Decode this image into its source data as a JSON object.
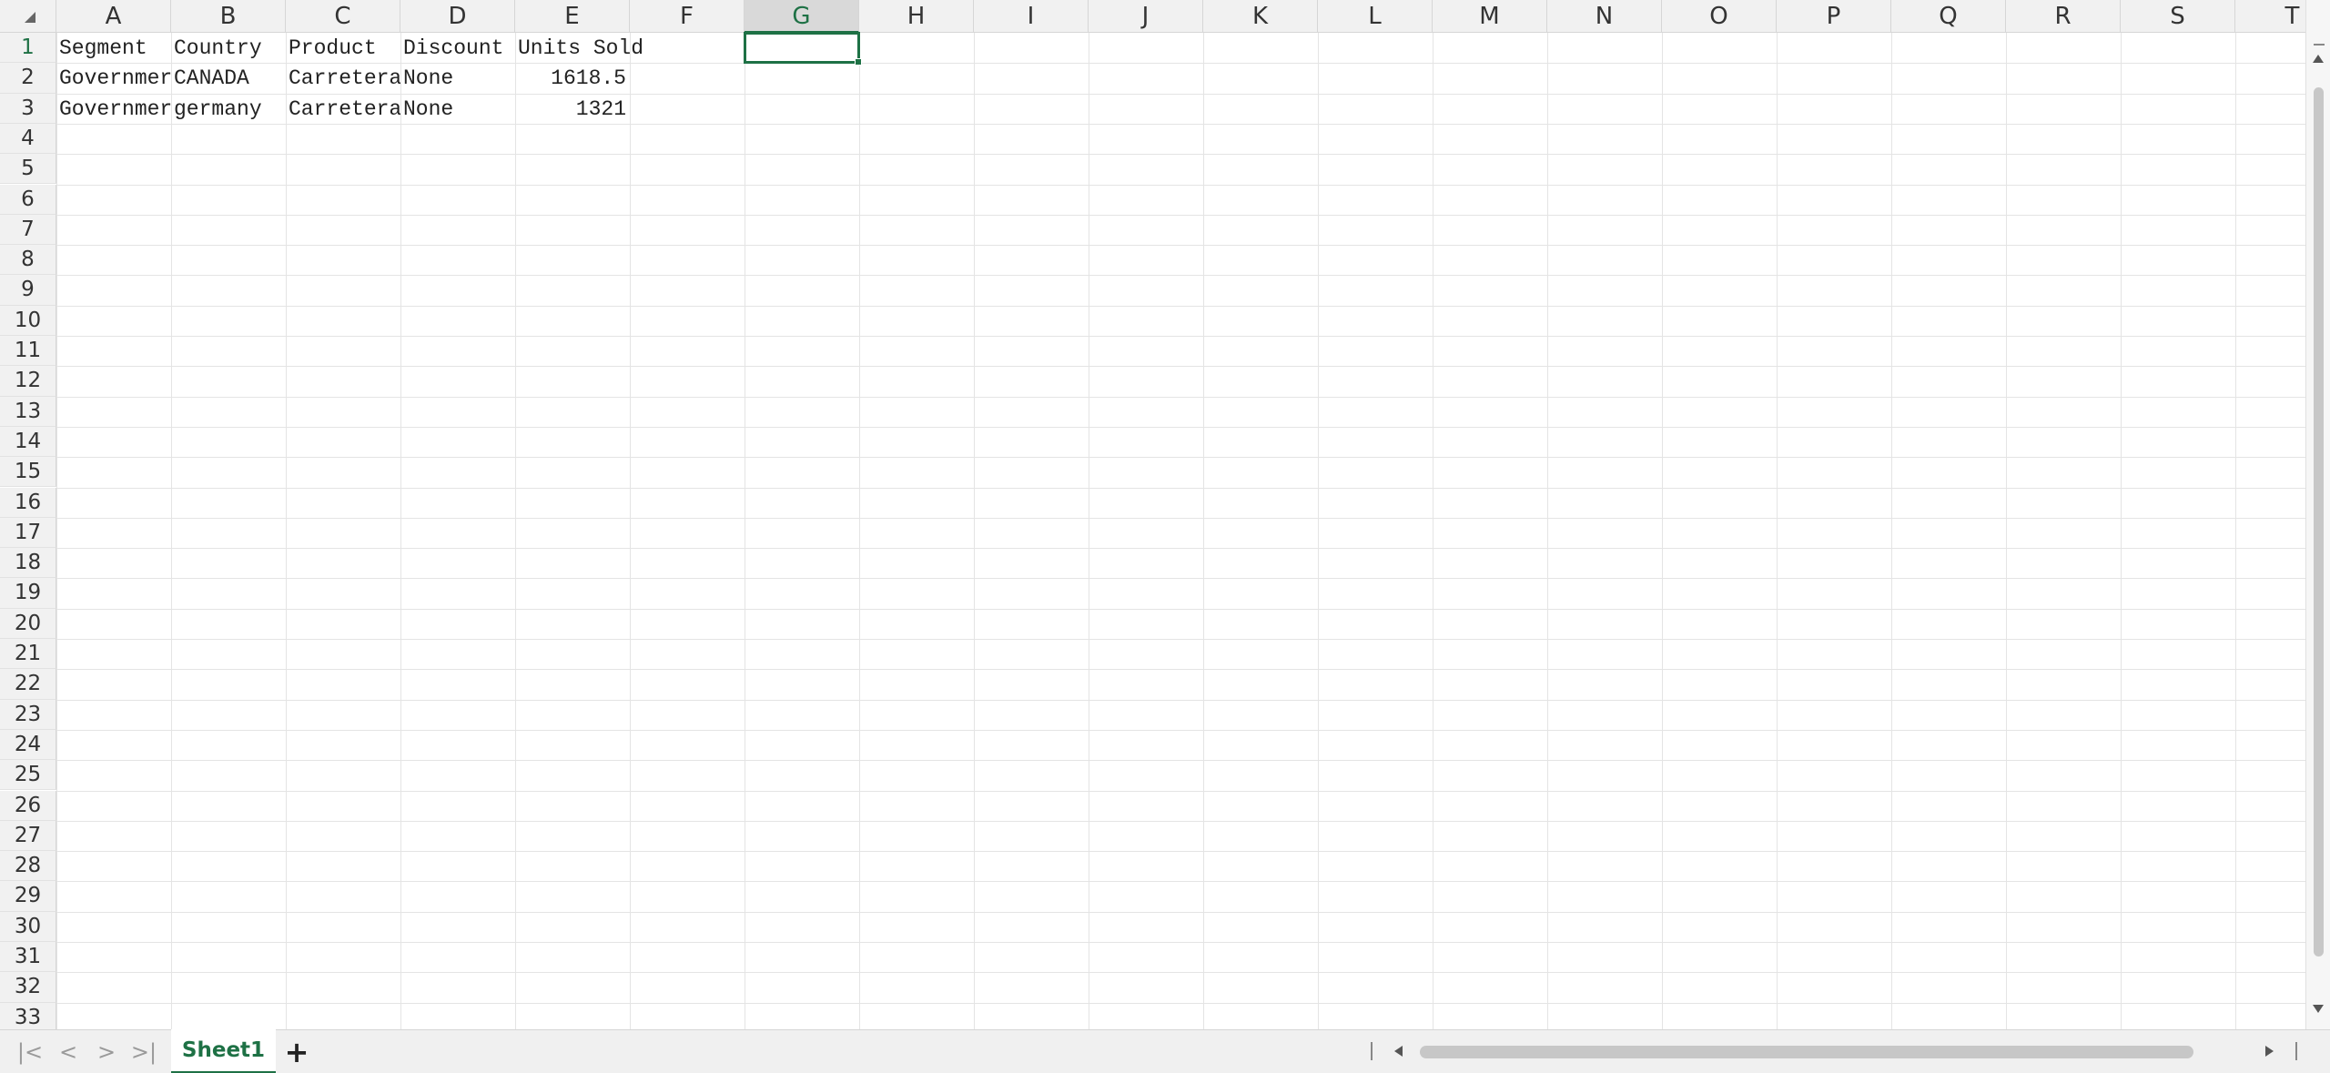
{
  "columns": [
    "A",
    "B",
    "C",
    "D",
    "E",
    "F",
    "G",
    "H",
    "I",
    "J",
    "K",
    "L",
    "M",
    "N",
    "O",
    "P",
    "Q",
    "R",
    "S",
    "T"
  ],
  "active_column": "G",
  "active_row": 1,
  "rows": [
    "1",
    "2",
    "3",
    "4",
    "5",
    "6",
    "7",
    "8",
    "9",
    "10",
    "11",
    "12",
    "13",
    "14",
    "15",
    "16",
    "17",
    "18",
    "19",
    "20",
    "21",
    "22",
    "23",
    "24",
    "25",
    "26",
    "27",
    "28",
    "29",
    "30",
    "31",
    "32",
    "33"
  ],
  "cells": {
    "A1": "Segment",
    "B1": "Country",
    "C1": "Product",
    "D1": "Discount",
    "E1": "Units Sold",
    "A2": "Governmer",
    "B2": "CANADA",
    "C2": "Carretera",
    "D2": "None",
    "E2": "1618.5",
    "A3": "Governmer",
    "B3": "germany",
    "C3": "Carretera",
    "D3": "None",
    "E3": "1321"
  },
  "sheet_tabs": [
    "Sheet1"
  ],
  "active_sheet": "Sheet1",
  "add_sheet_label": "+",
  "nav": {
    "first": "|<",
    "prev": "<",
    "next": ">",
    "last": ">|"
  },
  "colors": {
    "accent": "#1e7145",
    "header_bg": "#f1f1f1",
    "gridline": "#e4e4e4"
  }
}
